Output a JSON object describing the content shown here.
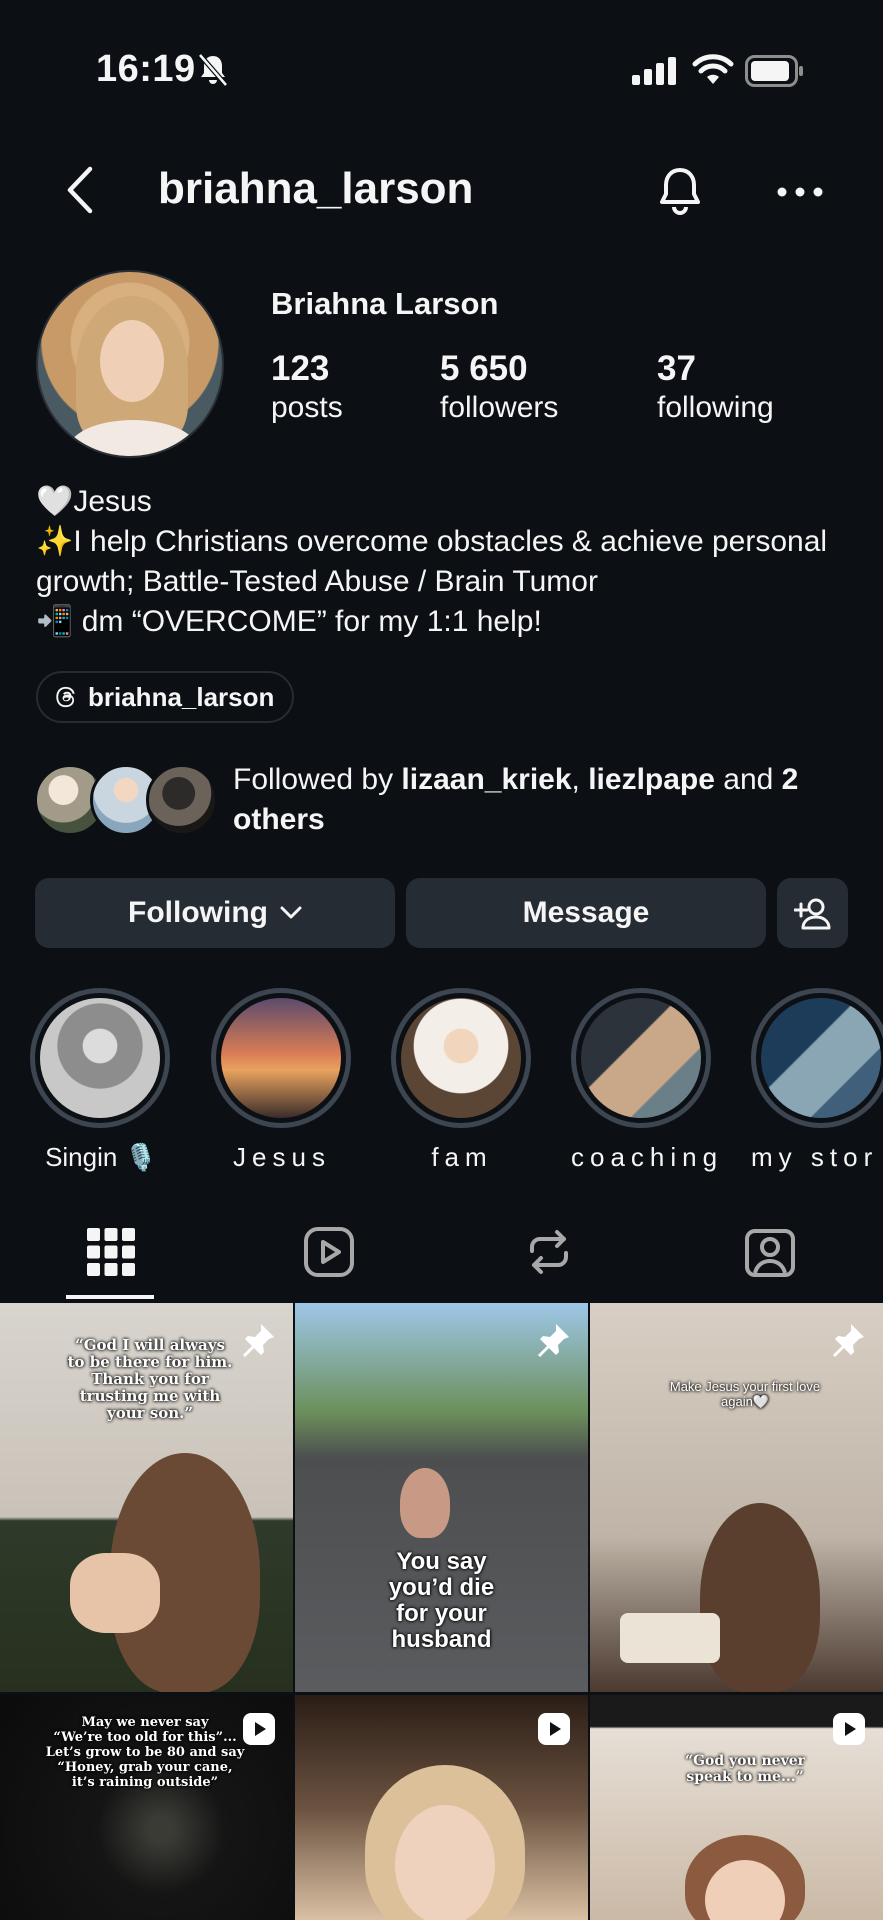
{
  "status_bar": {
    "time": "16:19"
  },
  "header": {
    "username": "briahna_larson"
  },
  "profile": {
    "full_name": "Briahna Larson",
    "stats": [
      {
        "value": "123",
        "label": "posts"
      },
      {
        "value": "5 650",
        "label": "followers"
      },
      {
        "value": "37",
        "label": "following"
      }
    ],
    "bio": "🤍Jesus\n✨I help Christians overcome obstacles & achieve personal growth; Battle-Tested Abuse / Brain Tumor\n📲 dm “OVERCOME” for my 1:1 help!",
    "threads_handle": "briahna_larson",
    "followed_by": {
      "prefix": "Followed by ",
      "user1": "lizaan_kriek",
      "sep": ", ",
      "user2": "liezlpape",
      "mid": " and ",
      "others": "2 others"
    }
  },
  "actions": {
    "following_label": "Following",
    "message_label": "Message"
  },
  "highlights": [
    {
      "label": "Singin 🎙️"
    },
    {
      "label": "Jesus"
    },
    {
      "label": "fam"
    },
    {
      "label": "coaching"
    },
    {
      "label": "my stor"
    }
  ],
  "tabs": [
    "grid-icon",
    "reels-icon",
    "reposts-icon",
    "tagged-icon"
  ],
  "posts": [
    {
      "type": "pinned",
      "caption": "“God I will always\nto be there for him.\nThank you for\ntrusting me with\nyour son.”"
    },
    {
      "type": "pinned",
      "caption": "You say\nyou’d die\nfor your\nhusband"
    },
    {
      "type": "pinned",
      "caption": "Make Jesus your first love\nagain🤍"
    },
    {
      "type": "reel",
      "caption": "May we never say\n“We’re too old for this”...\nLet’s grow to be 80 and say\n“Honey, grab your cane,\nit’s raining outside”"
    },
    {
      "type": "reel",
      "caption": ""
    },
    {
      "type": "reel",
      "caption": "“God you never\nspeak to me...”"
    }
  ]
}
